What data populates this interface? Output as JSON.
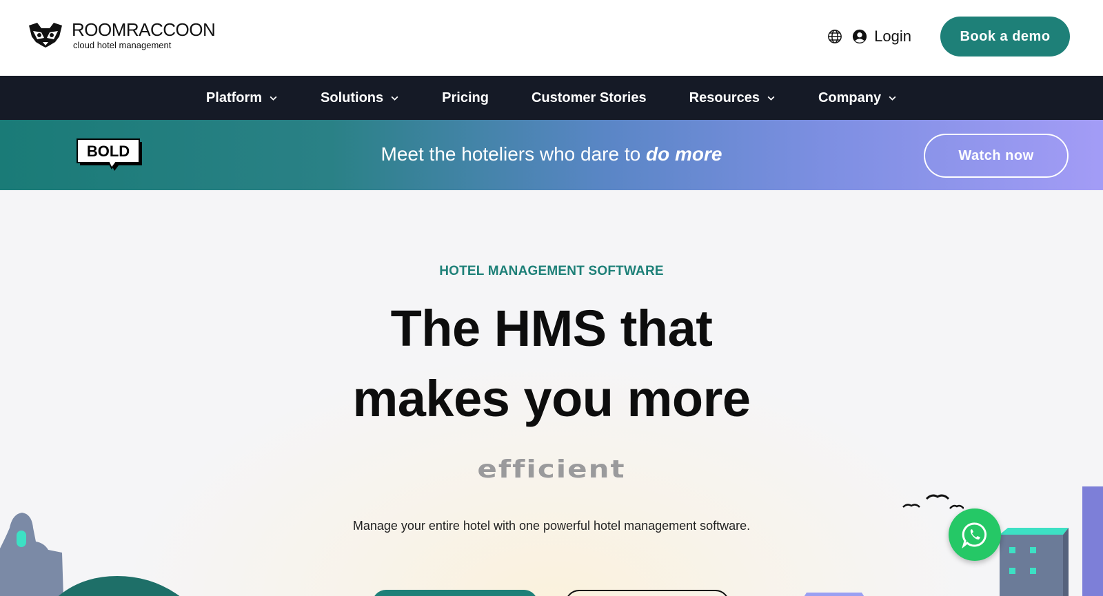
{
  "header": {
    "logo_name": "ROOMRACCOON",
    "logo_tagline": "cloud hotel management",
    "login_label": "Login",
    "book_demo_label": "Book a demo"
  },
  "nav": {
    "items": [
      {
        "label": "Platform",
        "has_dropdown": true
      },
      {
        "label": "Solutions",
        "has_dropdown": true
      },
      {
        "label": "Pricing",
        "has_dropdown": false
      },
      {
        "label": "Customer Stories",
        "has_dropdown": false
      },
      {
        "label": "Resources",
        "has_dropdown": true
      },
      {
        "label": "Company",
        "has_dropdown": true
      }
    ]
  },
  "banner": {
    "badge": "BOLD",
    "text_lead": "Meet the hoteliers who dare to ",
    "text_emphasis": "do more",
    "watch_label": "Watch now"
  },
  "hero": {
    "eyebrow": "HOTEL MANAGEMENT SOFTWARE",
    "headline_line1": "The HMS that",
    "headline_line2": "makes you more",
    "rotating_word": "efficient",
    "subtext": "Manage your entire hotel with one powerful hotel management software."
  },
  "colors": {
    "brand_teal": "#1e8078",
    "nav_bg": "#151a26",
    "whatsapp_green": "#25c866"
  },
  "icons": [
    "raccoon-logo-icon",
    "globe-icon",
    "user-icon",
    "chevron-down-icon",
    "bold-speech-bubble-icon",
    "whatsapp-icon"
  ]
}
